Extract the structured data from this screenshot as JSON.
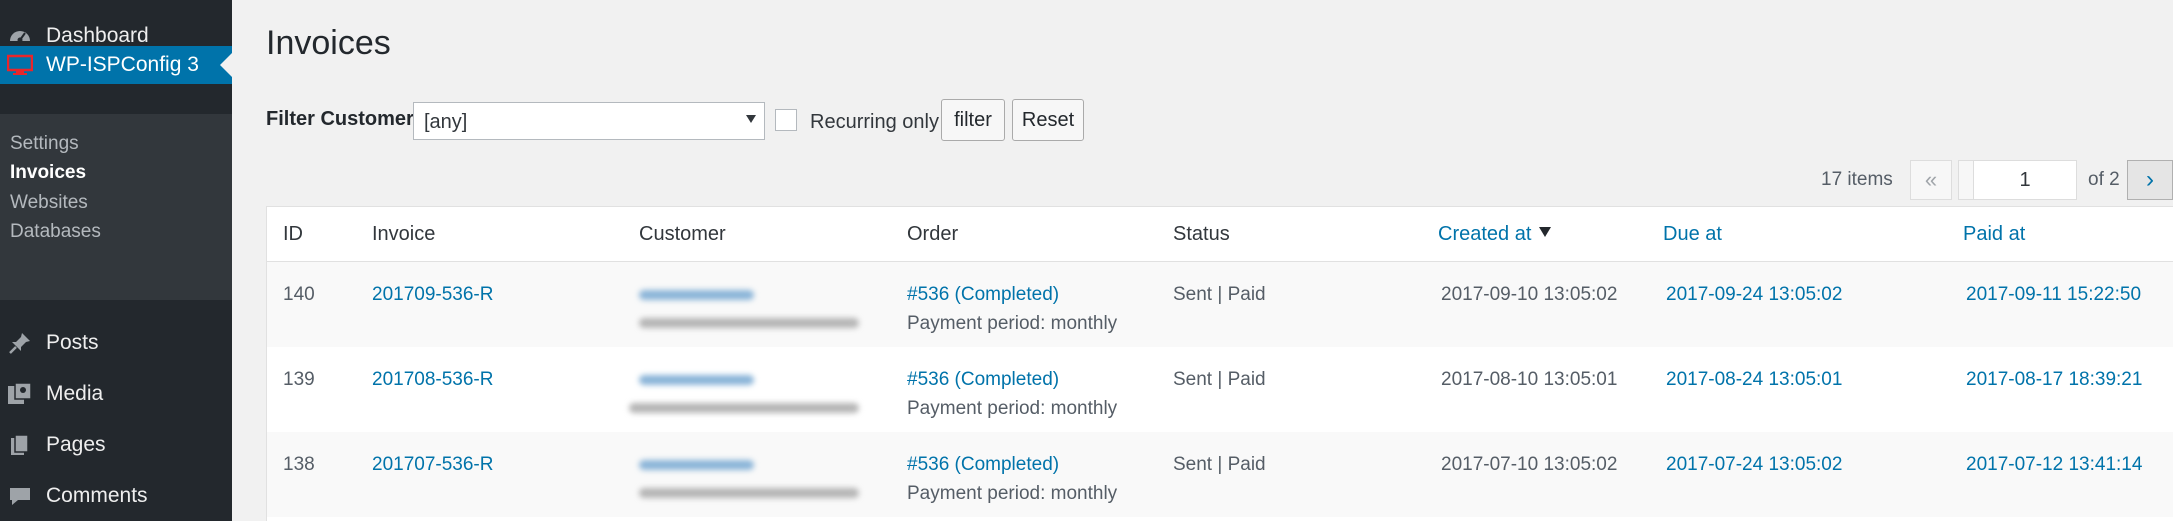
{
  "sidebar": {
    "menu": [
      {
        "label": "Dashboard",
        "icon": "dashboard-icon"
      },
      {
        "label": "WP-ISPConfig 3",
        "icon": "monitor-icon"
      },
      {
        "label": "Posts",
        "icon": "pin-icon"
      },
      {
        "label": "Media",
        "icon": "media-icon"
      },
      {
        "label": "Pages",
        "icon": "pages-icon"
      },
      {
        "label": "Comments",
        "icon": "comment-icon"
      }
    ],
    "submenu": [
      "Settings",
      "Invoices",
      "Websites",
      "Databases"
    ]
  },
  "page": {
    "title": "Invoices"
  },
  "filter": {
    "label": "Filter Customer:",
    "select_value": "[any]",
    "recurring_label": "Recurring only",
    "filter_button": "filter",
    "reset_button": "Reset"
  },
  "pagination": {
    "items_count": "17 items",
    "first": "«",
    "prev": "‹",
    "current_page": "1",
    "of_text": "of 2",
    "next": "›"
  },
  "table": {
    "headers": [
      "ID",
      "Invoice",
      "Customer",
      "Order",
      "Status",
      "Created at",
      "Due at",
      "Paid at"
    ],
    "rows": [
      {
        "id": "140",
        "invoice": "201709-536-R",
        "order": "#536 (Completed)",
        "period": "Payment period: monthly",
        "status": "Sent | Paid",
        "created": "2017-09-10 13:05:02",
        "due": "2017-09-24 13:05:02",
        "paid": "2017-09-11 15:22:50"
      },
      {
        "id": "139",
        "invoice": "201708-536-R",
        "order": "#536 (Completed)",
        "period": "Payment period: monthly",
        "status": "Sent | Paid",
        "created": "2017-08-10 13:05:01",
        "due": "2017-08-24 13:05:01",
        "paid": "2017-08-17 18:39:21"
      },
      {
        "id": "138",
        "invoice": "201707-536-R",
        "order": "#536 (Completed)",
        "period": "Payment period: monthly",
        "status": "Sent | Paid",
        "created": "2017-07-10 13:05:02",
        "due": "2017-07-24 13:05:02",
        "paid": "2017-07-12 13:41:14"
      }
    ]
  },
  "colors": {
    "accent": "#0073aa",
    "sidebar": "#23282d",
    "submenu": "#32373c"
  }
}
